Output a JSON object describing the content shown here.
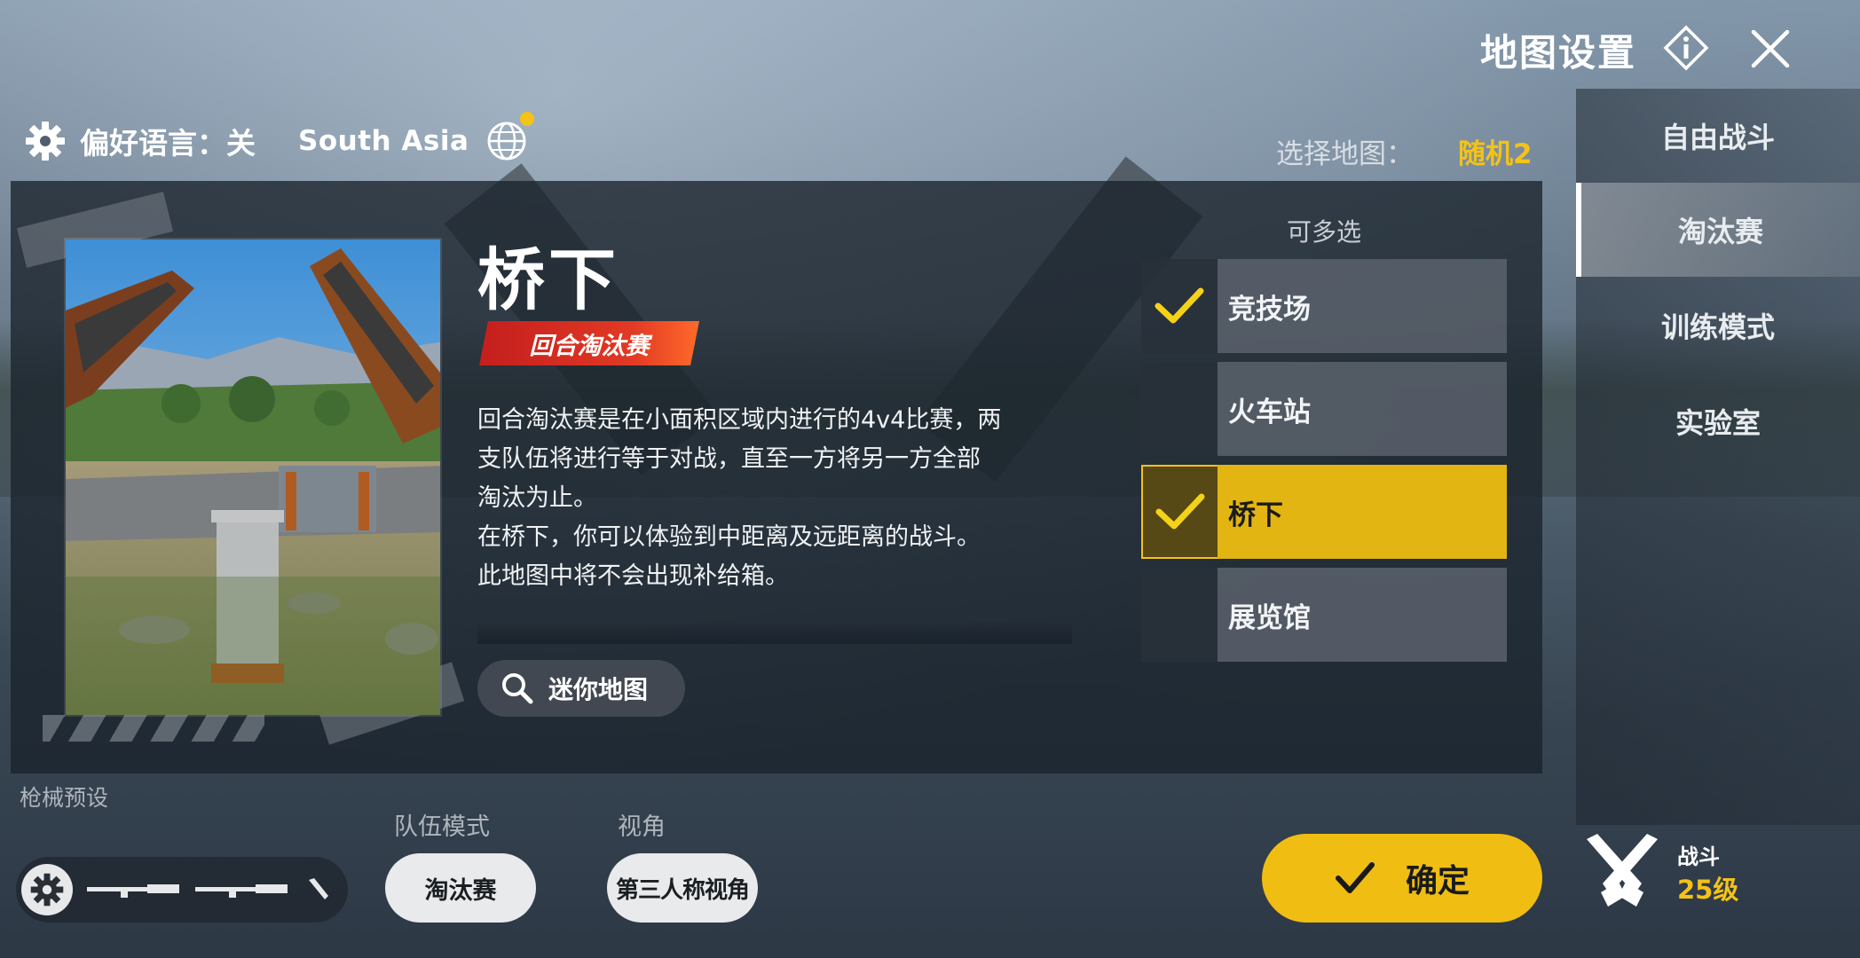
{
  "header": {
    "title": "地图设置",
    "info_icon": "info-icon",
    "close_icon": "close-icon"
  },
  "preferences": {
    "language_label": "偏好语言：关",
    "region": "South Asia",
    "region_notice_color": "#f4c218"
  },
  "map_selection": {
    "label": "选择地图：",
    "value": "随机2"
  },
  "modes": [
    {
      "label": "自由战斗",
      "active": false
    },
    {
      "label": "淘汰赛",
      "active": true
    },
    {
      "label": "训练模式",
      "active": false
    },
    {
      "label": "实验室",
      "active": false
    }
  ],
  "map_detail": {
    "title": "桥下",
    "mode_badge": "回合淘汰赛",
    "description": [
      "回合淘汰赛是在小面积区域内进行的4v4比赛，两",
      "支队伍将进行等于对战，直至一方将另一方全部",
      "淘汰为止。",
      "在桥下，你可以体验到中距离及远距离的战斗。",
      "此地图中将不会出现补给箱。"
    ],
    "minimap_button": "迷你地图"
  },
  "map_list": {
    "header": "可多选",
    "items": [
      {
        "name": "竞技场",
        "checked": true,
        "highlighted": false
      },
      {
        "name": "火车站",
        "checked": false,
        "highlighted": false
      },
      {
        "name": "桥下",
        "checked": true,
        "highlighted": true
      },
      {
        "name": "展览馆",
        "checked": false,
        "highlighted": false
      }
    ]
  },
  "bottom": {
    "gun_preset_label": "枪械预设",
    "team_mode_label": "队伍模式",
    "team_mode_value": "淘汰赛",
    "view_label": "视角",
    "view_value": "第三人称视角",
    "confirm_label": "确定"
  },
  "rank": {
    "title": "战斗",
    "level": "25级"
  },
  "colors": {
    "accent": "#f0bd12",
    "badge_red": "#d62a22",
    "panel": "#1a222c"
  }
}
